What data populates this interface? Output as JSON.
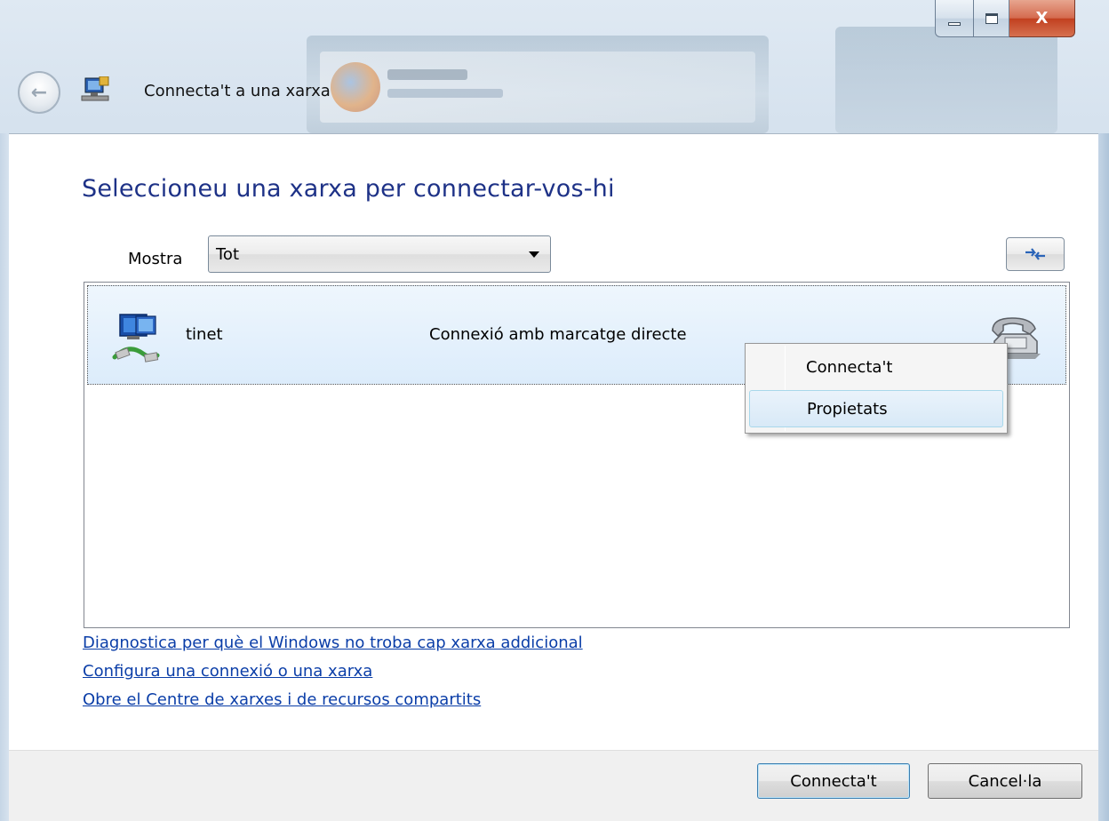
{
  "window": {
    "title": "Connecta't a una xarxa",
    "caption": {
      "minimize": "",
      "maximize": "",
      "close": "X"
    }
  },
  "main": {
    "heading": "Seleccioneu una xarxa per connectar-vos-hi",
    "show_label": "Mostra",
    "show_value": "Tot"
  },
  "networks": [
    {
      "name": "tinet",
      "type": "Connexió amb marcatge directe",
      "icon": "dialup-network-icon",
      "status_icon": "telephone-icon"
    }
  ],
  "context_menu": {
    "items": [
      {
        "label": "Connecta't"
      },
      {
        "label": "Propietats",
        "highlighted": true
      }
    ]
  },
  "links": [
    "Diagnostica per què el Windows no troba cap xarxa addicional",
    "Configura una connexió o una xarxa",
    "Obre el Centre de xarxes i de recursos compartits"
  ],
  "buttons": {
    "connect": "Connecta't",
    "cancel": "Cancel·la"
  },
  "colors": {
    "heading": "#1e3287",
    "link": "#0b3ea8",
    "selection": "#dcecfb"
  }
}
